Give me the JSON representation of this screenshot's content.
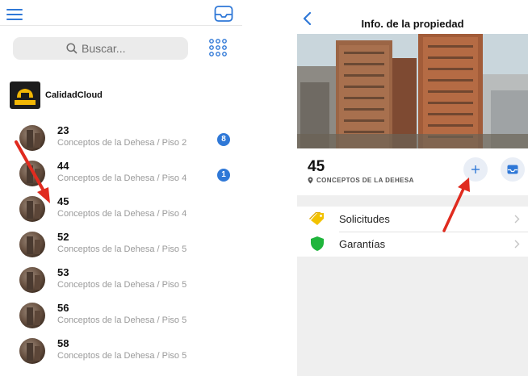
{
  "left_panel": {
    "search": {
      "placeholder": "Buscar..."
    },
    "brand": {
      "name": "CalidadCloud",
      "logo_text": "CALIDAD CLOUD"
    },
    "properties": [
      {
        "number": "23",
        "location": "Conceptos de la Dehesa / Piso 2",
        "badge": "8"
      },
      {
        "number": "44",
        "location": "Conceptos de la Dehesa / Piso 4",
        "badge": "1"
      },
      {
        "number": "45",
        "location": "Conceptos de la Dehesa / Piso 4",
        "badge": null
      },
      {
        "number": "52",
        "location": "Conceptos de la Dehesa / Piso 5",
        "badge": null
      },
      {
        "number": "53",
        "location": "Conceptos de la Dehesa / Piso 5",
        "badge": null
      },
      {
        "number": "56",
        "location": "Conceptos de la Dehesa / Piso 5",
        "badge": null
      },
      {
        "number": "58",
        "location": "Conceptos de la Dehesa / Piso 5",
        "badge": null
      }
    ],
    "icons": {
      "menu": "hamburger-icon",
      "inbox": "inbox-icon",
      "grid": "grid-icon",
      "search": "search-icon"
    }
  },
  "right_panel": {
    "nav": {
      "title": "Info. de la propiedad",
      "back_icon": "chevron-left-icon"
    },
    "property": {
      "number": "45",
      "location": "CONCEPTOS DE LA DEHESA"
    },
    "actions": {
      "add_icon": "plus-icon",
      "inbox_icon": "inbox-icon"
    },
    "menu": [
      {
        "label": "Solicitudes",
        "icon": "tag-icon",
        "color": "#f2c200"
      },
      {
        "label": "Garantías",
        "icon": "shield-icon",
        "color": "#1fb53c"
      }
    ]
  },
  "colors": {
    "accent": "#2f78d7",
    "annotation": "#e02b1f"
  }
}
